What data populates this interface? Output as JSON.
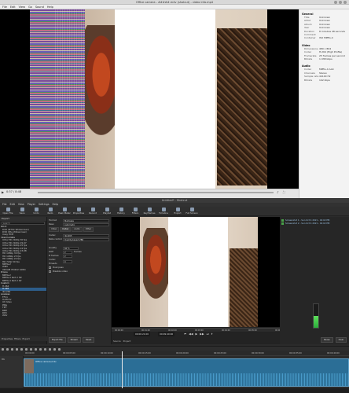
{
  "media_window": {
    "title": "Office camera - #####.m4v (shotcut) - video info.mp4",
    "menu": [
      "File",
      "Edit",
      "View",
      "Go",
      "Sound",
      "Help"
    ],
    "time": "0:37 / 8:48",
    "info": {
      "general_label": "General",
      "general": [
        {
          "k": "Title",
          "v": "Unknown"
        },
        {
          "k": "Artist",
          "v": "Unknown"
        },
        {
          "k": "Album",
          "v": "Unknown"
        },
        {
          "k": "Year",
          "v": "Unknown"
        },
        {
          "k": "Duration",
          "v": "8 minutes 48 seconds"
        },
        {
          "k": "Comment",
          "v": ""
        },
        {
          "k": "Container",
          "v": "ISO MPEG-4"
        }
      ],
      "video_label": "Video",
      "video": [
        {
          "k": "Dimensions",
          "v": "480 x 864"
        },
        {
          "k": "Codec",
          "v": "H.264 (High Profile)"
        },
        {
          "k": "Framerate",
          "v": "25 frames per second"
        },
        {
          "k": "Bitrate",
          "v": "1 038 kbps"
        }
      ],
      "audio_label": "Audio",
      "audio": [
        {
          "k": "Codec",
          "v": "MPEG-4 AAC"
        },
        {
          "k": "Channels",
          "v": "Stereo"
        },
        {
          "k": "Sample rate",
          "v": "44100 Hz"
        },
        {
          "k": "Bitrate",
          "v": "192 kbps"
        }
      ]
    }
  },
  "shotcut": {
    "title": "Untitled* - Shotcut",
    "menu": [
      "File",
      "Edit",
      "View",
      "Player",
      "Settings",
      "Help"
    ],
    "toolbar": [
      "Open File",
      "Save",
      "Undo",
      "Redo",
      "Peak Meter",
      "Properties",
      "Recent",
      "Playlist",
      "History",
      "Filters",
      "Keyframes",
      "Timeline",
      "Export",
      "Full Screen"
    ],
    "playlist": {
      "header": "Export",
      "search_placeholder": "search",
      "groups": [
        {
          "name": "stock",
          "items": [
            "DVD (NTSC Widescreen)",
            "DVD (PAL Widescreen)",
            "lossy PCM"
          ]
        },
        {
          "name": "intermediate",
          "items": [
            "Ultra HD 2160p 30 fps",
            "Ultra HD 2160p 29.97",
            "Ultra HD 2160p 25 fps",
            "Ultra HD 2160p 24 fps",
            "Ultra HD 2160p 23.98",
            "HD 1080p 30 fps",
            "HD 1080p 25 fps",
            "HD 1080p 24 fps",
            "HD 720p 50 fps",
            "MPEG-2",
            "WMV",
            "XDCAM HD422 1080i"
          ]
        },
        {
          "name": "Prores",
          "items": [
            "MPEG-2",
            "MPEG-4 Part 2 HP",
            "MPEG-4 Part 2 SP"
          ]
        },
        {
          "name": "Custom",
          "items": [
            "H.264",
            "H.265",
            "libx264"
          ]
        },
        {
          "name": "Lossless",
          "items": [
            "FFV1",
            "HuffYUV",
            "Ut Video",
            "PNG",
            "TIFF",
            "BMP",
            "DPX",
            "WAV"
          ]
        }
      ],
      "selected": "H.265",
      "tabs": [
        "Properties",
        "Filters",
        "Export"
      ]
    },
    "properties": {
      "format_label": "Format",
      "format_value": "Matroska",
      "resolution_label": "Reso",
      "resolution_value": "Automatic",
      "tabs": [
        "Video",
        "Codec",
        "Audio",
        "Other"
      ],
      "codec_label": "Codec",
      "codec_value": "libx265",
      "rate_control_label": "Rate control",
      "rate_control_value": "Quality-based VBR",
      "quality_label": "Quality",
      "quality_value": "60 %",
      "gop_label": "GOP",
      "gop_value": "2",
      "gop_unit": "frames",
      "bframes_label": "B frames",
      "bframes_value": "2",
      "threads_label": "Codec threads",
      "threads_value": "0",
      "dual_pass": "Dual pass",
      "disable_video": "Disable video",
      "buttons": [
        "Export File",
        "Stream",
        "Reset"
      ]
    },
    "player": {
      "timecode_in": "00:00:21:00",
      "timecode_dur": "00:09:40:00",
      "ruler": [
        "00:00:00",
        "00:01:00",
        "00:02:00",
        "00:03:00",
        "00:04:00",
        "00:05:00",
        "00:06:00"
      ],
      "controls": [
        "⏮",
        "◀◀",
        "▶",
        "▶▶",
        "⏭",
        "⏵"
      ],
      "tabs": [
        "Source",
        "Project"
      ]
    },
    "recent": [
      "Screenshot 1 - Sun Oct 4 2021 - 02:02 PM",
      "Screenshot 2 - Sun Oct 4 2021 - 02:02 PM"
    ],
    "meter_level": 0.5,
    "right_footer": [
      "Pause",
      "Clear"
    ],
    "timeline": {
      "ruler": [
        "00:00:00",
        "00:00:05:00",
        "00:00:10:00",
        "00:00:15:00",
        "00:00:20:00",
        "00:00:25:00",
        "00:00:30:00",
        "00:00:35:00",
        "00:00:40:00"
      ],
      "track_name": "V1",
      "clip_label": "Office camera.m4v"
    }
  }
}
